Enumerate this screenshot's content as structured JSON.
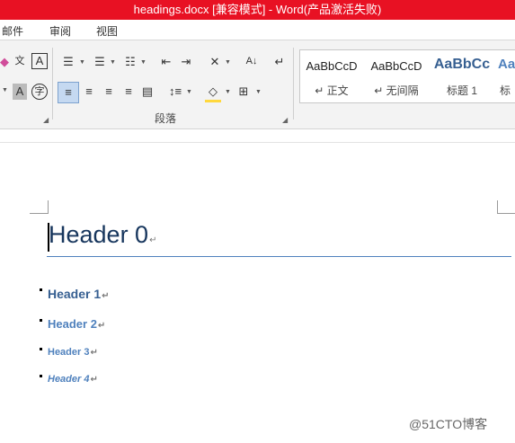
{
  "window": {
    "title": "headings.docx [兼容模式] - Word(产品激活失败)"
  },
  "menu": [
    "邮件",
    "审阅",
    "视图"
  ],
  "ribbon": {
    "group_label": "段落",
    "styles": [
      {
        "preview": "AaBbCcD",
        "name": "↵ 正文"
      },
      {
        "preview": "AaBbCcD",
        "name": "↵ 无间隔"
      },
      {
        "preview": "AaBbCc",
        "name": "标题 1"
      },
      {
        "preview": "Aa",
        "name": "标"
      }
    ]
  },
  "document": {
    "title": "Header 0",
    "paragraph_mark": "↵",
    "headings": [
      {
        "text": "Header 1"
      },
      {
        "text": "Header 2"
      },
      {
        "text": "Header 3"
      },
      {
        "text": "Header 4"
      }
    ]
  },
  "watermark": "@51CTO博客",
  "colors": {
    "titlebar": "#e81123",
    "heading": "#365f91",
    "title_text": "#17365d",
    "title_rule": "#4f81bd"
  }
}
